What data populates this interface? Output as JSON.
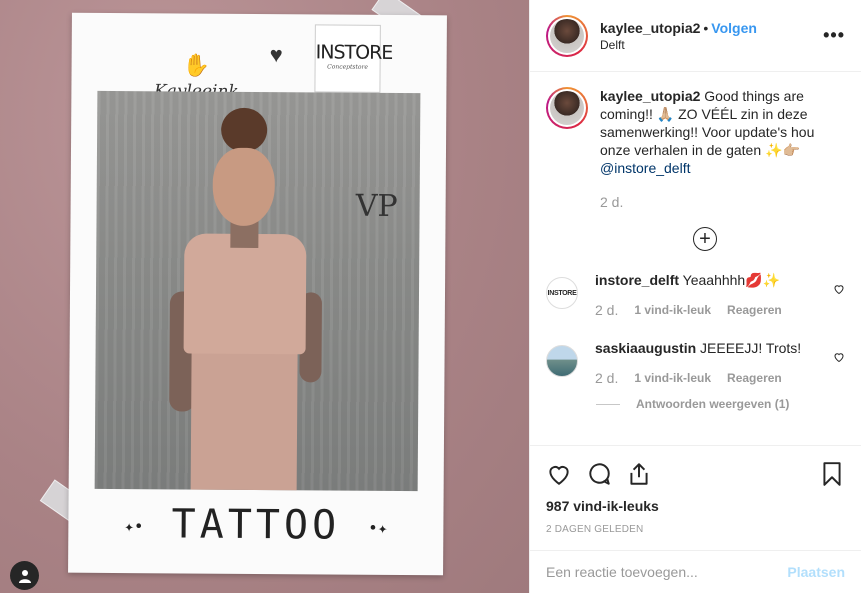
{
  "media": {
    "brand_left": "Kayleeink",
    "heart": "♥",
    "instore_title": "INSTORE",
    "instore_sub": "Conceptstore",
    "graffiti": "VP",
    "caption_text": "TATTOO",
    "caption_flourish_left": "✦•",
    "caption_flourish_right": "•✦"
  },
  "header": {
    "username": "kaylee_utopia2",
    "dot": "•",
    "follow_label": "Volgen",
    "location": "Delft",
    "more_icon": "•••"
  },
  "caption": {
    "username": "kaylee_utopia2",
    "text": "Good things are coming!! 🙏🏼 ZO VÉÉL zin in deze samenwerking!! Voor update's hou onze verhalen in de gaten ✨👉🏼",
    "mention": "@instore_delft",
    "time": "2 d.",
    "load_more_icon": "+"
  },
  "comments": [
    {
      "username": "instore_delft",
      "avatar_text": "INSTORE",
      "text": "Yeaahhhh💋✨",
      "time": "2 d.",
      "likes": "1 vind-ik-leuk",
      "reply": "Reageren"
    },
    {
      "username": "saskiaaugustin",
      "text": "JEEEEJJ! Trots!",
      "time": "2 d.",
      "likes": "1 vind-ik-leuk",
      "reply": "Reageren",
      "view_replies": "Antwoorden weergeven (1)"
    }
  ],
  "actions": {
    "likes_count": "987 vind-ik-leuks",
    "posted_ago": "2 DAGEN GELEDEN"
  },
  "add_comment": {
    "placeholder": "Een reactie toevoegen...",
    "post_label": "Plaatsen"
  },
  "colors": {
    "link_blue": "#3897f0",
    "post_disabled": "#b2dffc",
    "mention": "#003569"
  }
}
